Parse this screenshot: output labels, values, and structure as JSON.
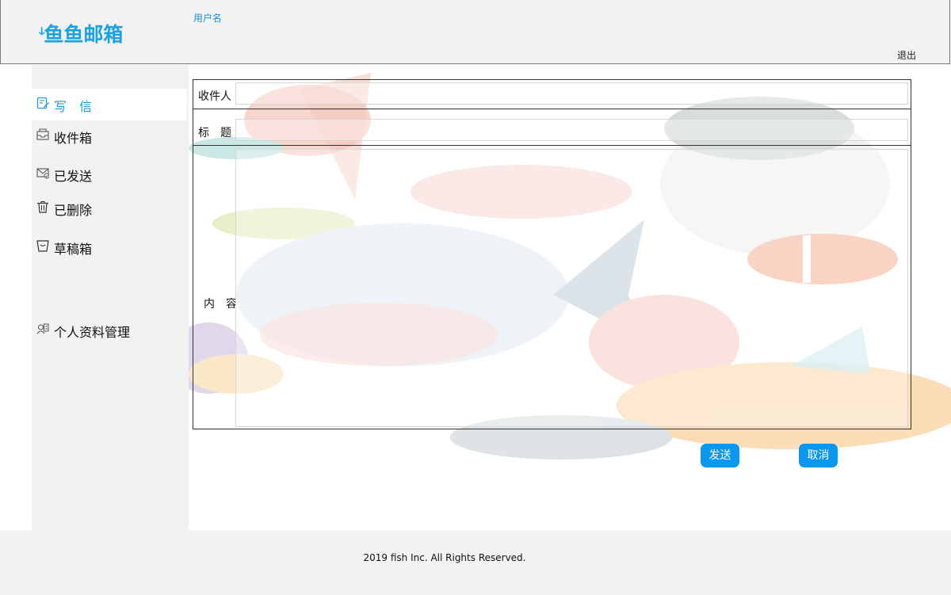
{
  "header": {
    "logo_mark": "ↆ",
    "logo_text": "鱼鱼邮箱",
    "username": "用户名",
    "logout": "退出"
  },
  "sidebar": {
    "items": [
      {
        "label": "写　信",
        "icon": "pencil-note-icon",
        "active": true
      },
      {
        "label": "收件箱",
        "icon": "inbox-envelope-icon",
        "active": false
      },
      {
        "label": "已发送",
        "icon": "sent-envelope-icon",
        "active": false
      },
      {
        "label": "已删除",
        "icon": "trash-icon",
        "active": false
      },
      {
        "label": "草稿箱",
        "icon": "draft-bin-icon",
        "active": false
      },
      {
        "label": "个人资料管理",
        "icon": "profile-card-icon",
        "active": false
      }
    ]
  },
  "compose": {
    "recipient_label": "收件人",
    "recipient_value": "",
    "subject_label": "标　题",
    "subject_value": "",
    "content_label": "内　容",
    "content_value": "",
    "send_button": "发送",
    "cancel_button": "取消"
  },
  "footer": {
    "copyright": "2019 fish Inc. All Rights Reserved."
  },
  "colors": {
    "accent": "#0a97ef",
    "brand": "#1aa1e6",
    "panel_bg": "#f2f2f2"
  }
}
